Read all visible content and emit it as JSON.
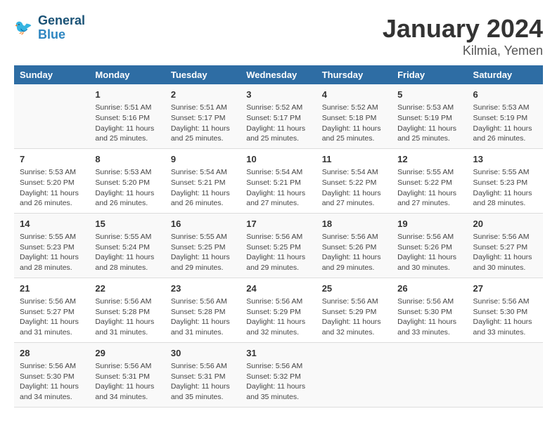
{
  "logo": {
    "line1": "General",
    "line2": "Blue"
  },
  "title": "January 2024",
  "subtitle": "Kilmia, Yemen",
  "headers": [
    "Sunday",
    "Monday",
    "Tuesday",
    "Wednesday",
    "Thursday",
    "Friday",
    "Saturday"
  ],
  "weeks": [
    [
      {
        "day": "",
        "content": ""
      },
      {
        "day": "1",
        "content": "Sunrise: 5:51 AM\nSunset: 5:16 PM\nDaylight: 11 hours\nand 25 minutes."
      },
      {
        "day": "2",
        "content": "Sunrise: 5:51 AM\nSunset: 5:17 PM\nDaylight: 11 hours\nand 25 minutes."
      },
      {
        "day": "3",
        "content": "Sunrise: 5:52 AM\nSunset: 5:17 PM\nDaylight: 11 hours\nand 25 minutes."
      },
      {
        "day": "4",
        "content": "Sunrise: 5:52 AM\nSunset: 5:18 PM\nDaylight: 11 hours\nand 25 minutes."
      },
      {
        "day": "5",
        "content": "Sunrise: 5:53 AM\nSunset: 5:19 PM\nDaylight: 11 hours\nand 25 minutes."
      },
      {
        "day": "6",
        "content": "Sunrise: 5:53 AM\nSunset: 5:19 PM\nDaylight: 11 hours\nand 26 minutes."
      }
    ],
    [
      {
        "day": "7",
        "content": "Sunrise: 5:53 AM\nSunset: 5:20 PM\nDaylight: 11 hours\nand 26 minutes."
      },
      {
        "day": "8",
        "content": "Sunrise: 5:53 AM\nSunset: 5:20 PM\nDaylight: 11 hours\nand 26 minutes."
      },
      {
        "day": "9",
        "content": "Sunrise: 5:54 AM\nSunset: 5:21 PM\nDaylight: 11 hours\nand 26 minutes."
      },
      {
        "day": "10",
        "content": "Sunrise: 5:54 AM\nSunset: 5:21 PM\nDaylight: 11 hours\nand 27 minutes."
      },
      {
        "day": "11",
        "content": "Sunrise: 5:54 AM\nSunset: 5:22 PM\nDaylight: 11 hours\nand 27 minutes."
      },
      {
        "day": "12",
        "content": "Sunrise: 5:55 AM\nSunset: 5:22 PM\nDaylight: 11 hours\nand 27 minutes."
      },
      {
        "day": "13",
        "content": "Sunrise: 5:55 AM\nSunset: 5:23 PM\nDaylight: 11 hours\nand 28 minutes."
      }
    ],
    [
      {
        "day": "14",
        "content": "Sunrise: 5:55 AM\nSunset: 5:23 PM\nDaylight: 11 hours\nand 28 minutes."
      },
      {
        "day": "15",
        "content": "Sunrise: 5:55 AM\nSunset: 5:24 PM\nDaylight: 11 hours\nand 28 minutes."
      },
      {
        "day": "16",
        "content": "Sunrise: 5:55 AM\nSunset: 5:25 PM\nDaylight: 11 hours\nand 29 minutes."
      },
      {
        "day": "17",
        "content": "Sunrise: 5:56 AM\nSunset: 5:25 PM\nDaylight: 11 hours\nand 29 minutes."
      },
      {
        "day": "18",
        "content": "Sunrise: 5:56 AM\nSunset: 5:26 PM\nDaylight: 11 hours\nand 29 minutes."
      },
      {
        "day": "19",
        "content": "Sunrise: 5:56 AM\nSunset: 5:26 PM\nDaylight: 11 hours\nand 30 minutes."
      },
      {
        "day": "20",
        "content": "Sunrise: 5:56 AM\nSunset: 5:27 PM\nDaylight: 11 hours\nand 30 minutes."
      }
    ],
    [
      {
        "day": "21",
        "content": "Sunrise: 5:56 AM\nSunset: 5:27 PM\nDaylight: 11 hours\nand 31 minutes."
      },
      {
        "day": "22",
        "content": "Sunrise: 5:56 AM\nSunset: 5:28 PM\nDaylight: 11 hours\nand 31 minutes."
      },
      {
        "day": "23",
        "content": "Sunrise: 5:56 AM\nSunset: 5:28 PM\nDaylight: 11 hours\nand 31 minutes."
      },
      {
        "day": "24",
        "content": "Sunrise: 5:56 AM\nSunset: 5:29 PM\nDaylight: 11 hours\nand 32 minutes."
      },
      {
        "day": "25",
        "content": "Sunrise: 5:56 AM\nSunset: 5:29 PM\nDaylight: 11 hours\nand 32 minutes."
      },
      {
        "day": "26",
        "content": "Sunrise: 5:56 AM\nSunset: 5:30 PM\nDaylight: 11 hours\nand 33 minutes."
      },
      {
        "day": "27",
        "content": "Sunrise: 5:56 AM\nSunset: 5:30 PM\nDaylight: 11 hours\nand 33 minutes."
      }
    ],
    [
      {
        "day": "28",
        "content": "Sunrise: 5:56 AM\nSunset: 5:30 PM\nDaylight: 11 hours\nand 34 minutes."
      },
      {
        "day": "29",
        "content": "Sunrise: 5:56 AM\nSunset: 5:31 PM\nDaylight: 11 hours\nand 34 minutes."
      },
      {
        "day": "30",
        "content": "Sunrise: 5:56 AM\nSunset: 5:31 PM\nDaylight: 11 hours\nand 35 minutes."
      },
      {
        "day": "31",
        "content": "Sunrise: 5:56 AM\nSunset: 5:32 PM\nDaylight: 11 hours\nand 35 minutes."
      },
      {
        "day": "",
        "content": ""
      },
      {
        "day": "",
        "content": ""
      },
      {
        "day": "",
        "content": ""
      }
    ]
  ]
}
